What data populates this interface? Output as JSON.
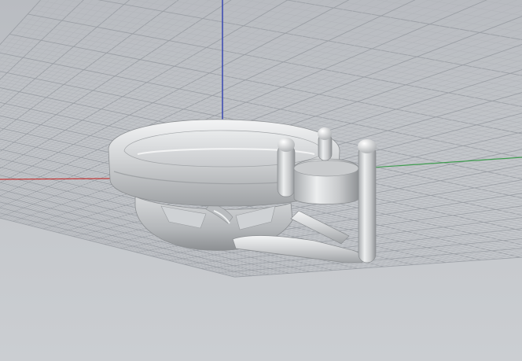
{
  "viewport": {
    "view": "perspective",
    "display_mode": "rendered",
    "model": "ring-with-prong-setting",
    "grid_visible": true
  },
  "colors": {
    "background": "#c2c5c9",
    "grid_minor": "#b3b6bb",
    "grid_major": "#9da1a7",
    "axis_x": "#c23a3a",
    "axis_y": "#3f9b4f",
    "axis_z": "#2f3fb0",
    "model_light": "#eef0f1",
    "model_mid": "#bcbfc1",
    "model_dark": "#8a8d90"
  }
}
